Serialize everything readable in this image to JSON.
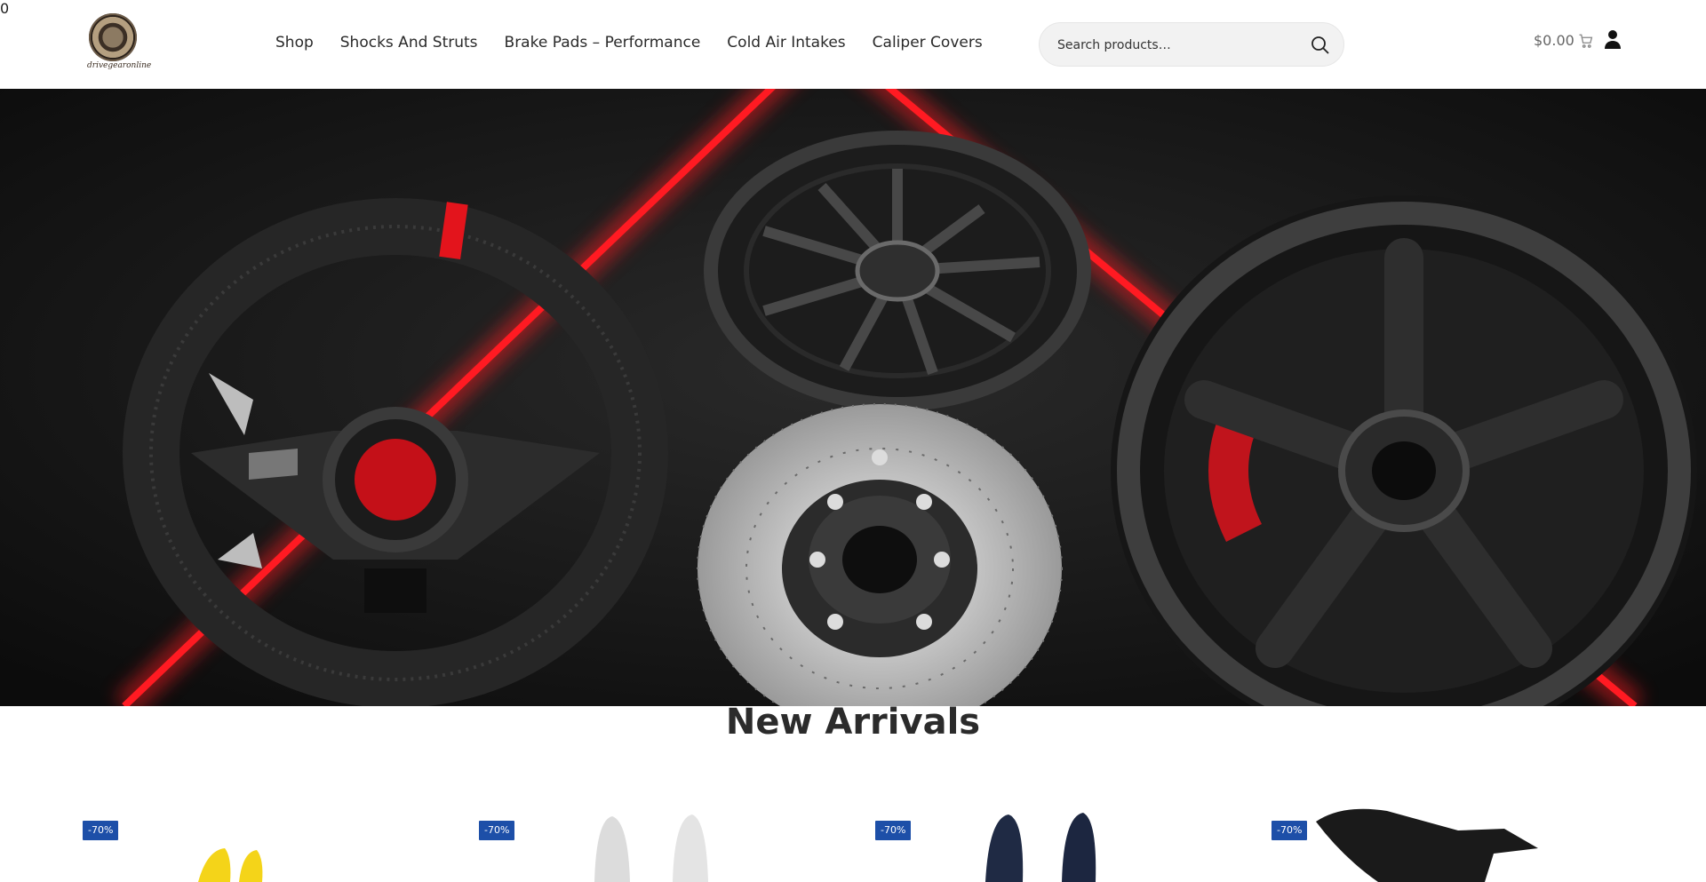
{
  "header": {
    "logo_alt": "drivegearonline",
    "nav": [
      {
        "label": "Shop"
      },
      {
        "label": "Shocks And Struts"
      },
      {
        "label": "Brake Pads – Performance"
      },
      {
        "label": "Cold Air Intakes"
      },
      {
        "label": "Caliper Covers"
      }
    ],
    "search": {
      "placeholder": "Search products…"
    },
    "cart": {
      "amount": "$0.00",
      "count": "0"
    }
  },
  "hero": {
    "accent_color": "#e3141c",
    "background_color": "#141414"
  },
  "new_arrivals": {
    "title": "New Arrivals",
    "products": [
      {
        "badge": "-70%",
        "color": "#f4d419"
      },
      {
        "badge": "-70%",
        "color": "#dcdcdc"
      },
      {
        "badge": "-70%",
        "color": "#1f2a44"
      },
      {
        "badge": "-70%",
        "color": "#1a1a1a"
      }
    ]
  }
}
